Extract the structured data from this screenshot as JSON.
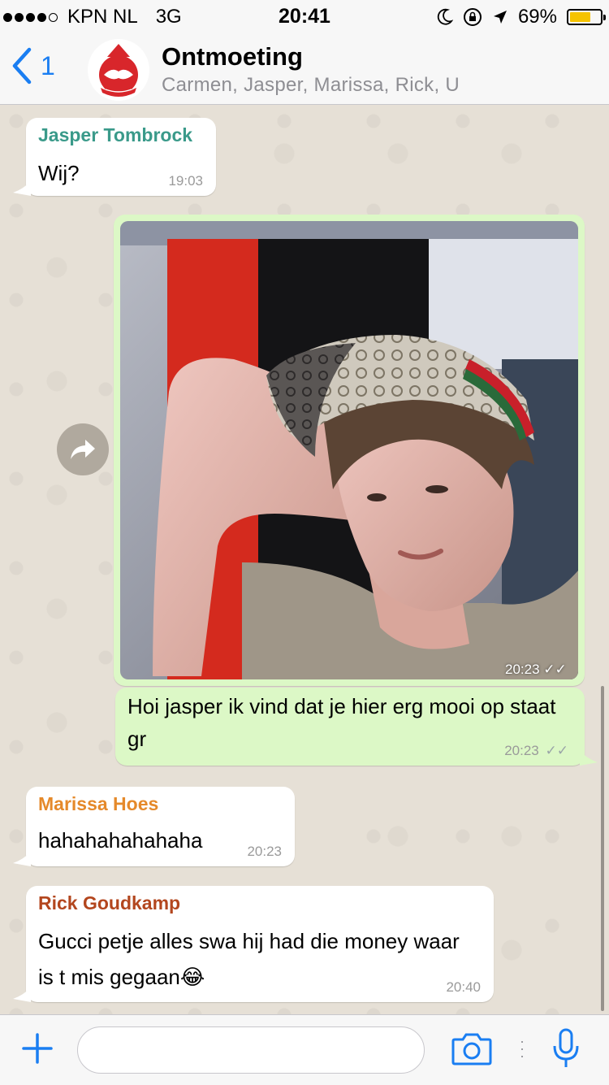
{
  "status_bar": {
    "carrier": "KPN NL",
    "network": "3G",
    "time": "20:41",
    "battery": "69%",
    "battery_level": 0.69,
    "icons": [
      "signal-dots-icon",
      "moon-icon",
      "orientation-lock-icon",
      "location-arrow-icon",
      "battery-icon"
    ]
  },
  "header": {
    "back_count": "1",
    "title": "Ontmoeting",
    "subtitle": "Carmen, Jasper, Marissa, Rick, U",
    "avatar_icon": "group-handshake-logo"
  },
  "messages": [
    {
      "sender": "Jasper Tombrock",
      "sender_color": "#3a9a8a",
      "text": "Wij?",
      "time": "19:03",
      "direction": "in"
    },
    {
      "type": "image",
      "time": "20:23",
      "direction": "out",
      "read": true
    },
    {
      "text": "Hoi jasper ik vind dat je hier erg mooi op staat gr",
      "time": "20:23",
      "direction": "out",
      "read": true
    },
    {
      "sender": "Marissa Hoes",
      "sender_color": "#e5892a",
      "text": "hahahahahahaha",
      "time": "20:23",
      "direction": "in"
    },
    {
      "sender": "Rick Goudkamp",
      "sender_color": "#b3461e",
      "text": "Gucci petje alles swa hij had die money waar is t mis gegaan😂",
      "time": "20:40",
      "direction": "in"
    }
  ],
  "colors": {
    "accent": "#1a7ef2",
    "out_bubble": "#dcf8c6",
    "in_bubble": "#ffffff"
  }
}
